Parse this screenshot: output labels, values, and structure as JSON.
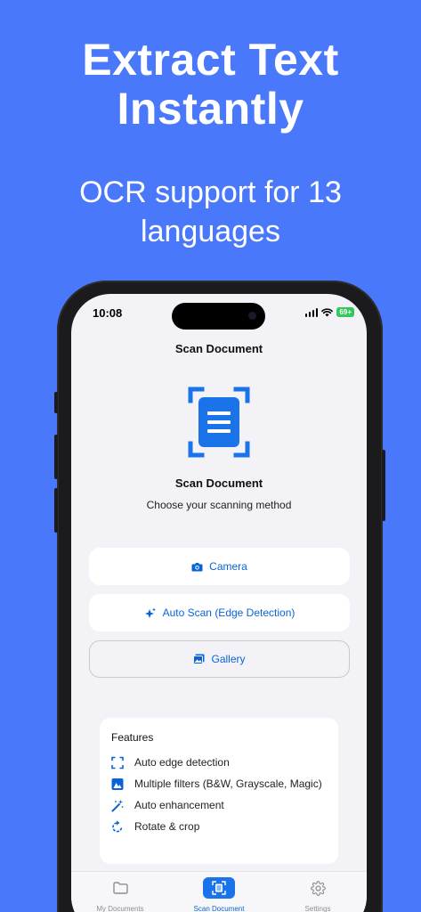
{
  "promo": {
    "headline_line1": "Extract Text",
    "headline_line2": "Instantly",
    "subheadline_line1": "OCR support for 13",
    "subheadline_line2": "languages"
  },
  "status_bar": {
    "time": "10:08",
    "battery": "69+"
  },
  "nav": {
    "title": "Scan Document"
  },
  "hero": {
    "icon": "document-scanner-icon",
    "title": "Scan Document",
    "subtitle": "Choose your scanning method"
  },
  "actions": [
    {
      "label": "Camera",
      "icon": "camera-icon"
    },
    {
      "label": "Auto Scan (Edge Detection)",
      "icon": "sparkles-icon"
    },
    {
      "label": "Gallery",
      "icon": "photo-icon"
    }
  ],
  "features": {
    "title": "Features",
    "items": [
      {
        "label": "Auto edge detection",
        "icon": "corner-brackets-icon"
      },
      {
        "label": "Multiple filters (B&W, Grayscale, Magic)",
        "icon": "filter-icon"
      },
      {
        "label": "Auto enhancement",
        "icon": "magic-wand-icon"
      },
      {
        "label": "Rotate & crop",
        "icon": "rotate-icon"
      }
    ]
  },
  "tabs": [
    {
      "label": "My Documents",
      "icon": "folder-icon",
      "active": false
    },
    {
      "label": "Scan Document",
      "icon": "scanner-icon",
      "active": true
    },
    {
      "label": "Settings",
      "icon": "gear-icon",
      "active": false
    }
  ],
  "colors": {
    "background": "#4a78fb",
    "accent": "#0a63d6",
    "active_tab": "#1a73e8",
    "battery": "#34c759"
  }
}
